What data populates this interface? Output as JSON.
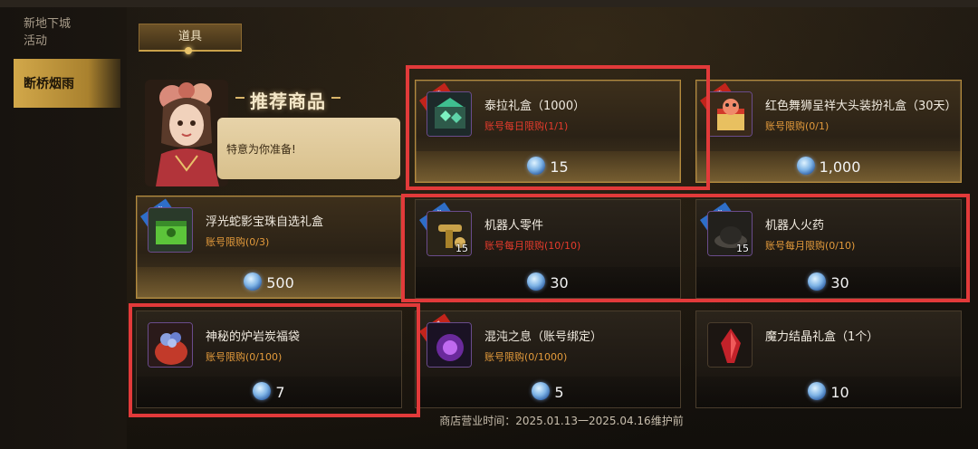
{
  "sidebar": {
    "items": [
      {
        "label": "新地下城"
      },
      {
        "label": "活动"
      },
      {
        "label": "断桥烟雨"
      }
    ]
  },
  "tabs": [
    {
      "label": "道具"
    }
  ],
  "promo": {
    "title": "推荐商品",
    "bubble_text": "特意为你准备!"
  },
  "currency_icon": "blue-gem-coin-icon",
  "products": [
    {
      "name": "泰拉礼盒（1000）",
      "limit": "账号每日限购(1/1)",
      "price": "15",
      "icon": "teal-chest-icon",
      "ribbon": "热卖",
      "highlighted": true
    },
    {
      "name": "红色舞狮呈祥大头装扮礼盒（30天）",
      "limit": "账号限购(0/1)",
      "price": "1,000",
      "icon": "lion-gift-box-icon",
      "ribbon": "热卖",
      "highlighted": true
    },
    {
      "name": "浮光蛇影宝珠自选礼盒",
      "limit": "账号限购(0/3)",
      "price": "500",
      "icon": "green-box-icon",
      "ribbon": "活动",
      "highlighted": true
    },
    {
      "name": "机器人零件",
      "limit": "账号每月限购(10/10)",
      "price": "30",
      "icon": "robot-part-icon",
      "qty": "15",
      "ribbon": "活动",
      "highlighted": false
    },
    {
      "name": "机器人火药",
      "limit": "账号每月限购(0/10)",
      "price": "30",
      "icon": "gunpowder-icon",
      "qty": "15",
      "ribbon": "活动",
      "highlighted": false
    },
    {
      "name": "神秘的炉岩炭福袋",
      "limit": "账号限购(0/100)",
      "price": "7",
      "icon": "lucky-bag-icon",
      "highlighted": false
    },
    {
      "name": "混沌之息（账号绑定）",
      "limit": "账号限购(0/1000)",
      "price": "5",
      "icon": "purple-flame-icon",
      "ribbon": "账号",
      "highlighted": false
    },
    {
      "name": "魔力结晶礼盒（1个）",
      "limit": "",
      "price": "10",
      "icon": "red-crystal-icon",
      "highlighted": false
    }
  ],
  "footer": {
    "text": "商店营业时间：2025.01.13一2025.04.16维护前"
  }
}
